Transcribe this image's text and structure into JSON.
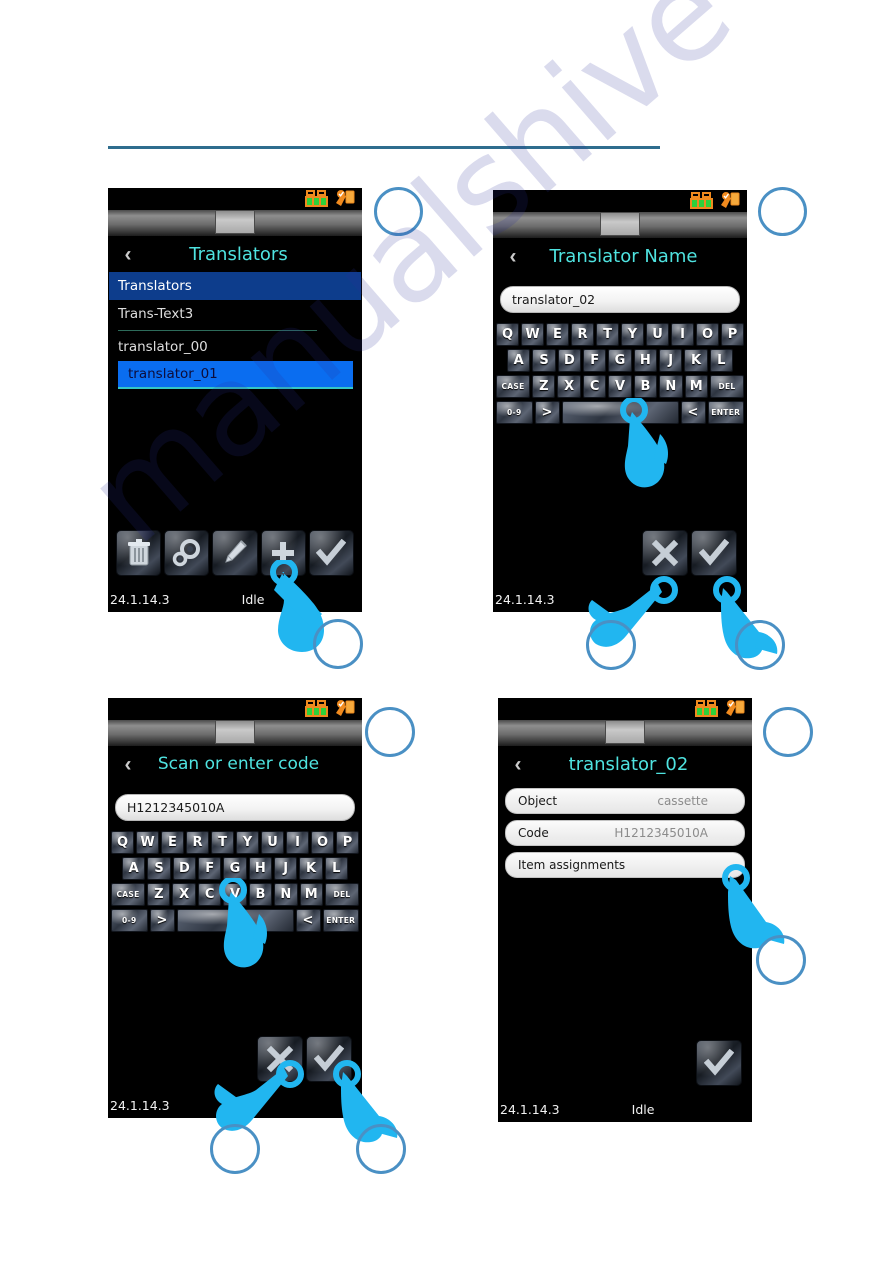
{
  "watermark": {
    "text": "manualshive"
  },
  "device": {
    "version": "24.1.14.3",
    "status_idle": "Idle",
    "back_chevron": "‹",
    "status_icons": {
      "battery": "battery-icon",
      "robot": "robot-scanner-icon"
    }
  },
  "keyboard": {
    "row1": [
      "Q",
      "W",
      "E",
      "R",
      "T",
      "Y",
      "U",
      "I",
      "O",
      "P"
    ],
    "row2": [
      "A",
      "S",
      "D",
      "F",
      "G",
      "H",
      "J",
      "K",
      "L"
    ],
    "row3_left": "CASE",
    "row3": [
      "Z",
      "X",
      "C",
      "V",
      "B",
      "N",
      "M"
    ],
    "row3_right": "DEL",
    "row4": {
      "num": "0-9",
      "next": ">",
      "space": "",
      "prev": "<",
      "enter": "ENTER"
    }
  },
  "panels": [
    {
      "id": "translators-list",
      "title": "Translators",
      "list": [
        {
          "label": "Translators",
          "kind": "group"
        },
        {
          "label": "Trans-Text3",
          "kind": "plain"
        },
        {
          "label": "translator_00",
          "kind": "plain"
        },
        {
          "label": "translator_01",
          "kind": "selected"
        }
      ],
      "toolbar": [
        {
          "name": "delete-button",
          "icon": "trash-icon"
        },
        {
          "name": "settings-button",
          "icon": "gears-icon"
        },
        {
          "name": "edit-button",
          "icon": "pencil-icon"
        },
        {
          "name": "add-button",
          "icon": "plus-icon"
        },
        {
          "name": "confirm-button",
          "icon": "check-icon"
        }
      ],
      "footer": {
        "version": "24.1.14.3",
        "status": "Idle"
      }
    },
    {
      "id": "translator-name",
      "title": "Translator Name",
      "input_value": "translator_02",
      "toolbar": [
        {
          "name": "cancel-button",
          "icon": "x-icon"
        },
        {
          "name": "confirm-button",
          "icon": "check-icon"
        }
      ],
      "footer": {
        "version": "24.1.14.3",
        "status": ""
      }
    },
    {
      "id": "scan-or-enter-code",
      "title": "Scan or enter code",
      "input_value": "H1212345010A",
      "toolbar": [
        {
          "name": "cancel-button",
          "icon": "x-icon"
        },
        {
          "name": "confirm-button",
          "icon": "check-icon"
        }
      ],
      "footer": {
        "version": "24.1.14.3",
        "status": ""
      }
    },
    {
      "id": "translator-detail",
      "title": "translator_02",
      "rows": [
        {
          "key": "Object",
          "value": "cassette"
        },
        {
          "key": "Code",
          "value": "H1212345010A"
        },
        {
          "key": "Item assignments",
          "value": ""
        }
      ],
      "toolbar": [
        {
          "name": "confirm-button",
          "icon": "check-icon"
        }
      ],
      "footer": {
        "version": "24.1.14.3",
        "status": "Idle"
      }
    }
  ]
}
